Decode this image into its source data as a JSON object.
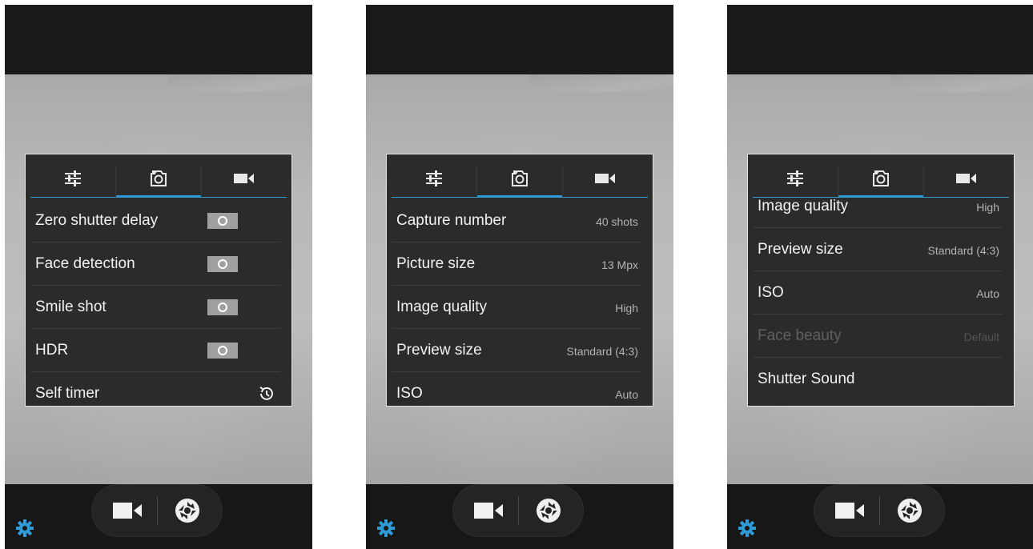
{
  "colors": {
    "accent": "#2e9bd6",
    "panel_bg": "#2b2b2b",
    "toggle_off": "#a0a0a0"
  },
  "icons": {
    "tab_settings": "sliders-icon",
    "tab_camera": "camera-icon",
    "tab_video": "video-camera-icon",
    "bottom_settings": "gear-icon",
    "mode_video": "video-camera-icon",
    "mode_photo": "aperture-shutter-icon",
    "self_timer": "timer-icon"
  },
  "screens": [
    {
      "rows": [
        {
          "label": "Zero shutter delay",
          "control": "toggle",
          "state": "off"
        },
        {
          "label": "Face detection",
          "control": "toggle",
          "state": "off"
        },
        {
          "label": "Smile shot",
          "control": "toggle",
          "state": "off"
        },
        {
          "label": "HDR",
          "control": "toggle",
          "state": "off"
        },
        {
          "label": "Self timer",
          "control": "timer-icon"
        }
      ]
    },
    {
      "rows": [
        {
          "label": "Capture number",
          "value": "40 shots"
        },
        {
          "label": "Picture size",
          "value": "13 Mpx"
        },
        {
          "label": "Image quality",
          "value": "High"
        },
        {
          "label": "Preview size",
          "value": "Standard (4:3)"
        },
        {
          "label": "ISO",
          "value": "Auto"
        }
      ]
    },
    {
      "rows": [
        {
          "label": "Image quality",
          "value": "High"
        },
        {
          "label": "Preview size",
          "value": "Standard (4:3)"
        },
        {
          "label": "ISO",
          "value": "Auto"
        },
        {
          "label": "Face beauty",
          "value": "Default",
          "disabled": true
        },
        {
          "label": "Shutter Sound",
          "value": ""
        }
      ]
    }
  ]
}
